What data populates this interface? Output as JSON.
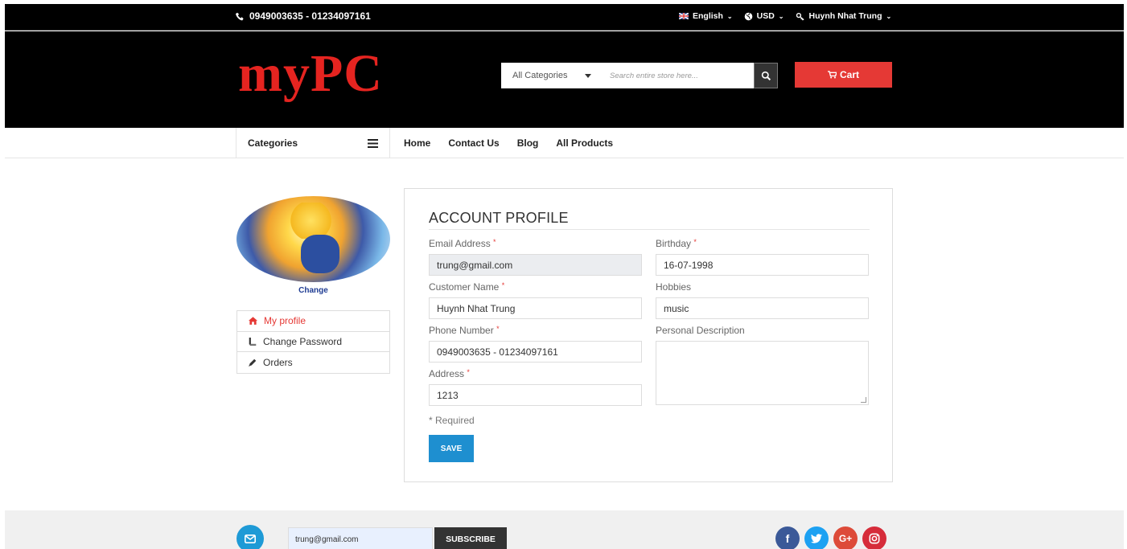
{
  "topbar": {
    "phone": "0949003635 - 01234097161",
    "language": "English",
    "currency": "USD",
    "user": "Huynh Nhat Trung"
  },
  "header": {
    "logo": "myPC",
    "search_category": "All Categories",
    "search_placeholder": "Search entire store here...",
    "cart_label": "Cart"
  },
  "nav": {
    "categories_label": "Categories",
    "links": [
      "Home",
      "Contact Us",
      "Blog",
      "All Products"
    ]
  },
  "sidebar": {
    "change_label": "Change",
    "menu": [
      "My profile",
      "Change Password",
      "Orders"
    ]
  },
  "profile": {
    "title": "ACCOUNT PROFILE",
    "email_label": "Email Address",
    "email_value": "trung@gmail.com",
    "name_label": "Customer Name",
    "name_value": "Huynh Nhat Trung",
    "phone_label": "Phone Number",
    "phone_value": "0949003635 - 01234097161",
    "address_label": "Address",
    "address_value": "1213",
    "birthday_label": "Birthday",
    "birthday_value": "16-07-1998",
    "hobbies_label": "Hobbies",
    "hobbies_value": "music",
    "description_label": "Personal Description",
    "required_note": "* Required",
    "save_label": "SAVE"
  },
  "footer": {
    "newsletter_email": "trung@gmail.com",
    "subscribe_label": "SUBSCRIBE",
    "social_colors": {
      "facebook": "#3b5998",
      "twitter": "#1da1f2",
      "googleplus": "#dd4b39",
      "instagram": "#d62c3a"
    }
  },
  "colors": {
    "accent_red": "#e53935",
    "save_blue": "#1e8fd0"
  }
}
